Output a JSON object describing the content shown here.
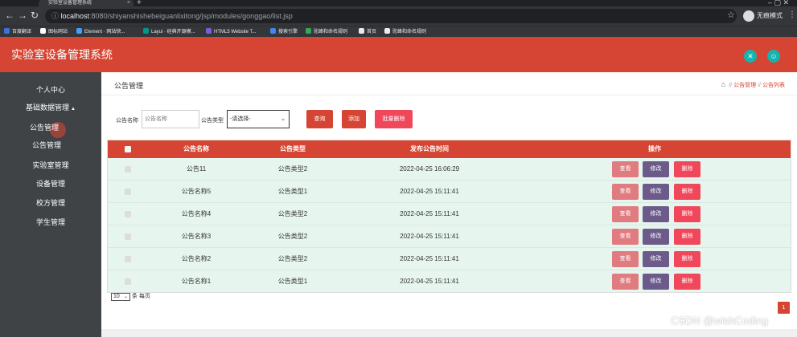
{
  "browser": {
    "tab_title": "实验室设备管理系统",
    "tab_close": "×",
    "new_tab": "+",
    "window_controls": "–  ▢  ✕",
    "url_host": "localhost",
    "url_path": ":8080/shiyanshishebeiguanlixitong/jsp/modules/gonggao/list.jsp",
    "profile_label": "无痕模式",
    "bookmarks": [
      {
        "label": "百度翻译",
        "color": "#3b73d9"
      },
      {
        "label": "图标网站",
        "color": "#ffffff"
      },
      {
        "label": "Element · 网站快...",
        "color": "#409eff"
      },
      {
        "label": "Layui · 经典开源模...",
        "color": "#009688"
      },
      {
        "label": "HTML5 Website T...",
        "color": "#7c5cd9"
      },
      {
        "label": "搜索引擎",
        "color": "#4285f4"
      },
      {
        "label": "驼峰和命名规则",
        "color": "#34a853"
      },
      {
        "label": "首页",
        "color": "#e8eaed"
      },
      {
        "label": "驼峰和命名规则",
        "color": "#e8eaed"
      }
    ]
  },
  "app": {
    "title": "实验室设备管理系统",
    "header_bg": "#d64533",
    "header_icons": [
      "fullscreen-icon",
      "user-icon"
    ]
  },
  "sidebar": {
    "items": [
      {
        "label": "个人中心"
      },
      {
        "label": "基础数据管理",
        "caret": "▲"
      },
      {
        "label": "公告管理"
      },
      {
        "label": "公告管理"
      },
      {
        "label": "实验室管理"
      },
      {
        "label": "设备管理"
      },
      {
        "label": "校方管理"
      },
      {
        "label": "学生管理"
      }
    ]
  },
  "page": {
    "title": "公告管理",
    "breadcrumb": [
      "公告管理",
      "公告列表"
    ]
  },
  "search": {
    "name_label": "公告名称",
    "name_placeholder": "公告名称",
    "type_label": "公告类型",
    "type_selected": "-请选择-",
    "search_button": "查询",
    "add_button": "添加",
    "batch_delete_button": "批量删除"
  },
  "table": {
    "headers": [
      "公告名称",
      "公告类型",
      "发布公告时间",
      "操作"
    ],
    "actions": {
      "view": "查看",
      "edit": "修改",
      "delete": "删除"
    },
    "rows": [
      {
        "name": "公告11",
        "type": "公告类型2",
        "time": "2022-04-25 16:06:29"
      },
      {
        "name": "公告名称5",
        "type": "公告类型1",
        "time": "2022-04-25 15:11:41"
      },
      {
        "name": "公告名称4",
        "type": "公告类型2",
        "time": "2022-04-25 15:11:41"
      },
      {
        "name": "公告名称3",
        "type": "公告类型2",
        "time": "2022-04-25 15:11:41"
      },
      {
        "name": "公告名称2",
        "type": "公告类型2",
        "time": "2022-04-25 15:11:41"
      },
      {
        "name": "公告名称1",
        "type": "公告类型1",
        "time": "2022-04-25 15:11:41"
      }
    ]
  },
  "pagination": {
    "page_size": "10",
    "page_size_suffix": "条 每页",
    "current_page": "1"
  },
  "watermark": "CSDN @wishCoding",
  "colors": {
    "brand": "#d64533",
    "view_button": "#e07b80",
    "edit_button": "#6c5b8a",
    "delete_button": "#f0475a",
    "sidebar": "#3f4346",
    "table_body": "#e6f5ee"
  }
}
